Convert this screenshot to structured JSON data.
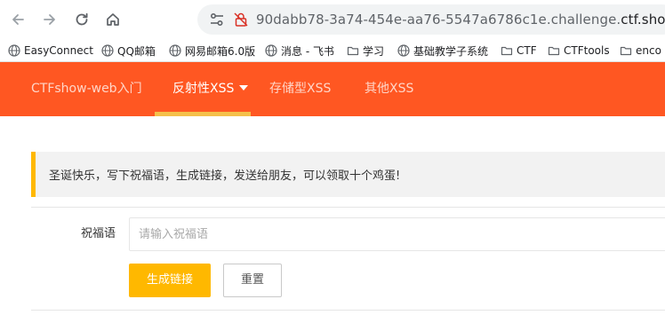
{
  "browser": {
    "url_prefix": "90dabb78-3a74-454e-aa76-5547a6786c1e.challenge.",
    "url_host": "ctf.show"
  },
  "bookmarks": [
    {
      "label": "EasyConnect",
      "icon": "globe-icon"
    },
    {
      "label": "QQ邮箱",
      "icon": "globe-icon"
    },
    {
      "label": "网易邮箱6.0版",
      "icon": "globe-icon"
    },
    {
      "label": "消息 - 飞书",
      "icon": "globe-icon"
    },
    {
      "label": "学习",
      "icon": "folder-icon"
    },
    {
      "label": "基础教学子系统",
      "icon": "globe-icon"
    },
    {
      "label": "CTF",
      "icon": "folder-icon"
    },
    {
      "label": "CTFtools",
      "icon": "folder-icon"
    },
    {
      "label": "enco",
      "icon": "folder-icon"
    }
  ],
  "nav": {
    "items": [
      {
        "label": "CTFshow-web入门"
      },
      {
        "label": "反射性XSS"
      },
      {
        "label": "存储型XSS"
      },
      {
        "label": "其他XSS"
      }
    ],
    "active_index": 1
  },
  "notice": {
    "text": "圣诞快乐，写下祝福语，生成链接，发送给朋友，可以领取十个鸡蛋!"
  },
  "form": {
    "label": "祝福语",
    "placeholder": "请输入祝福语",
    "value": "",
    "submit_label": "生成链接",
    "reset_label": "重置"
  },
  "colors": {
    "nav_bg": "#ff5722",
    "nav_underline": "#f5c04a",
    "primary_button": "#ffb800",
    "notice_border": "#ffb800"
  }
}
